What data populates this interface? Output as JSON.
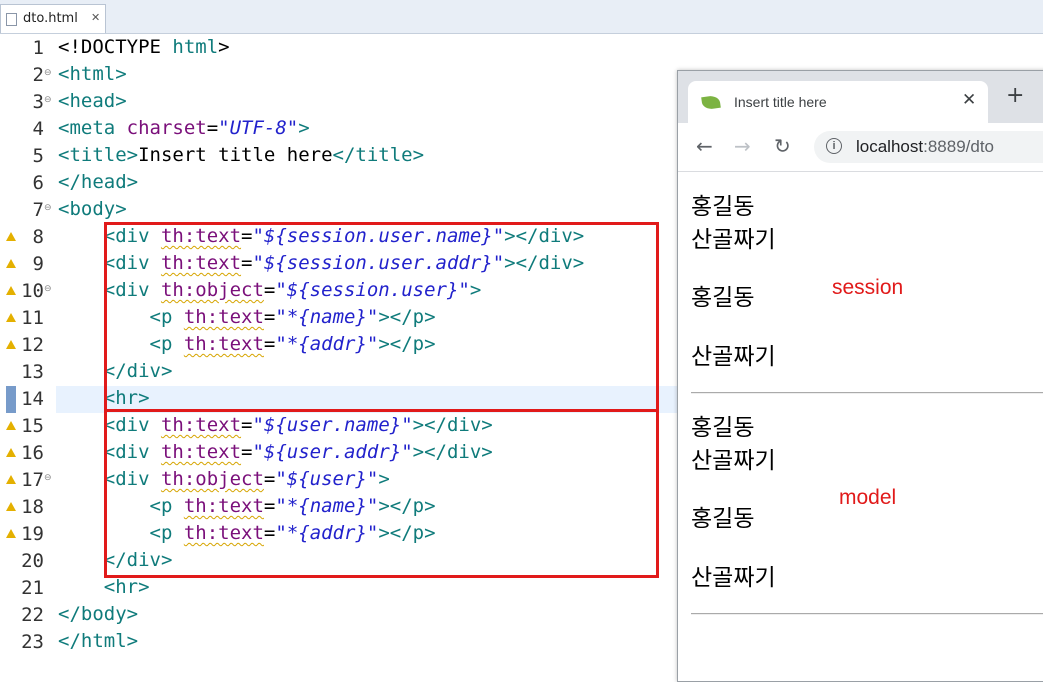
{
  "editor": {
    "tab_title": "dto.html",
    "tab_close": "✕",
    "lines": [
      {
        "num": "1",
        "tokens": [
          {
            "c": "x",
            "v": "<!DOCTYPE "
          },
          {
            "c": "t",
            "v": "html"
          },
          {
            "c": "x",
            "v": ">"
          }
        ]
      },
      {
        "num": "2",
        "tokens": [
          {
            "c": "t",
            "v": "<html>"
          }
        ]
      },
      {
        "num": "3",
        "tokens": [
          {
            "c": "t",
            "v": "<head>"
          }
        ]
      },
      {
        "num": "4",
        "tokens": [
          {
            "c": "t",
            "v": "<meta "
          },
          {
            "c": "ap",
            "v": "charset"
          },
          {
            "c": "x",
            "v": "="
          },
          {
            "c": "v",
            "v": "\"UTF-8\""
          },
          {
            "c": "t",
            "v": ">"
          }
        ]
      },
      {
        "num": "5",
        "tokens": [
          {
            "c": "t",
            "v": "<title>"
          },
          {
            "c": "x",
            "v": "Insert title here"
          },
          {
            "c": "t",
            "v": "</title>"
          }
        ]
      },
      {
        "num": "6",
        "tokens": [
          {
            "c": "t",
            "v": "</head>"
          }
        ]
      },
      {
        "num": "7",
        "tokens": [
          {
            "c": "t",
            "v": "<body>"
          }
        ]
      },
      {
        "num": "8",
        "tokens": [
          {
            "c": "t",
            "v": "    <div "
          },
          {
            "c": "a",
            "v": "th:text"
          },
          {
            "c": "x",
            "v": "="
          },
          {
            "c": "v",
            "v": "\"${session.user.name}\""
          },
          {
            "c": "t",
            "v": "></div>"
          }
        ]
      },
      {
        "num": "9",
        "tokens": [
          {
            "c": "t",
            "v": "    <div "
          },
          {
            "c": "a",
            "v": "th:text"
          },
          {
            "c": "x",
            "v": "="
          },
          {
            "c": "v",
            "v": "\"${session.user.addr}\""
          },
          {
            "c": "t",
            "v": "></div>"
          }
        ]
      },
      {
        "num": "10",
        "tokens": [
          {
            "c": "t",
            "v": "    <div "
          },
          {
            "c": "a",
            "v": "th:object"
          },
          {
            "c": "x",
            "v": "="
          },
          {
            "c": "v",
            "v": "\"${session.user}\""
          },
          {
            "c": "t",
            "v": ">"
          }
        ]
      },
      {
        "num": "11",
        "tokens": [
          {
            "c": "t",
            "v": "        <p "
          },
          {
            "c": "a",
            "v": "th:text"
          },
          {
            "c": "x",
            "v": "="
          },
          {
            "c": "v",
            "v": "\"*{name}\""
          },
          {
            "c": "t",
            "v": "></p>"
          }
        ]
      },
      {
        "num": "12",
        "tokens": [
          {
            "c": "t",
            "v": "        <p "
          },
          {
            "c": "a",
            "v": "th:text"
          },
          {
            "c": "x",
            "v": "="
          },
          {
            "c": "v",
            "v": "\"*{addr}\""
          },
          {
            "c": "t",
            "v": "></p>"
          }
        ]
      },
      {
        "num": "13",
        "tokens": [
          {
            "c": "t",
            "v": "    </div>"
          }
        ]
      },
      {
        "num": "14",
        "tokens": [
          {
            "c": "t",
            "v": "    <hr>"
          }
        ]
      },
      {
        "num": "15",
        "tokens": [
          {
            "c": "t",
            "v": "    <div "
          },
          {
            "c": "a",
            "v": "th:text"
          },
          {
            "c": "x",
            "v": "="
          },
          {
            "c": "v",
            "v": "\"${user.name}\""
          },
          {
            "c": "t",
            "v": "></div>"
          }
        ]
      },
      {
        "num": "16",
        "tokens": [
          {
            "c": "t",
            "v": "    <div "
          },
          {
            "c": "a",
            "v": "th:text"
          },
          {
            "c": "x",
            "v": "="
          },
          {
            "c": "v",
            "v": "\"${user.addr}\""
          },
          {
            "c": "t",
            "v": "></div>"
          }
        ]
      },
      {
        "num": "17",
        "tokens": [
          {
            "c": "t",
            "v": "    <div "
          },
          {
            "c": "a",
            "v": "th:object"
          },
          {
            "c": "x",
            "v": "="
          },
          {
            "c": "v",
            "v": "\"${user}\""
          },
          {
            "c": "t",
            "v": ">"
          }
        ]
      },
      {
        "num": "18",
        "tokens": [
          {
            "c": "t",
            "v": "        <p "
          },
          {
            "c": "a",
            "v": "th:text"
          },
          {
            "c": "x",
            "v": "="
          },
          {
            "c": "v",
            "v": "\"*{name}\""
          },
          {
            "c": "t",
            "v": "></p>"
          }
        ]
      },
      {
        "num": "19",
        "tokens": [
          {
            "c": "t",
            "v": "        <p "
          },
          {
            "c": "a",
            "v": "th:text"
          },
          {
            "c": "x",
            "v": "="
          },
          {
            "c": "v",
            "v": "\"*{addr}\""
          },
          {
            "c": "t",
            "v": "></p>"
          }
        ]
      },
      {
        "num": "20",
        "tokens": [
          {
            "c": "t",
            "v": "    </div>"
          }
        ]
      },
      {
        "num": "21",
        "tokens": [
          {
            "c": "t",
            "v": "    <hr>"
          }
        ]
      },
      {
        "num": "22",
        "tokens": [
          {
            "c": "t",
            "v": "</body>"
          }
        ]
      },
      {
        "num": "23",
        "tokens": [
          {
            "c": "t",
            "v": "</html>"
          }
        ]
      }
    ],
    "fold_lines": [
      "2",
      "3",
      "7",
      "10",
      "17"
    ],
    "warning_lines": [
      "8",
      "9",
      "10",
      "11",
      "12",
      "15",
      "16",
      "17",
      "18",
      "19"
    ],
    "current_line": "14"
  },
  "browser": {
    "tab_title": "Insert title here",
    "tab_close": "✕",
    "new_tab": "+",
    "back": "←",
    "forward": "→",
    "reload": "↻",
    "info": "i",
    "url_host": "localhost",
    "url_rest": ":8889/dto",
    "session_name_div": "홍길동",
    "session_addr_div": "산골짜기",
    "session_name_p": "홍길동",
    "session_addr_p": "산골짜기",
    "model_name_div": "홍길동",
    "model_addr_div": "산골짜기",
    "model_name_p": "홍길동",
    "model_addr_p": "산골짜기"
  },
  "annotations": {
    "session": "session",
    "model": "model"
  },
  "colors": {
    "highlight_box": "#e11a1a",
    "tag": "#0f7b7b",
    "attribute": "#7a0f7a",
    "value": "#2222cc"
  }
}
